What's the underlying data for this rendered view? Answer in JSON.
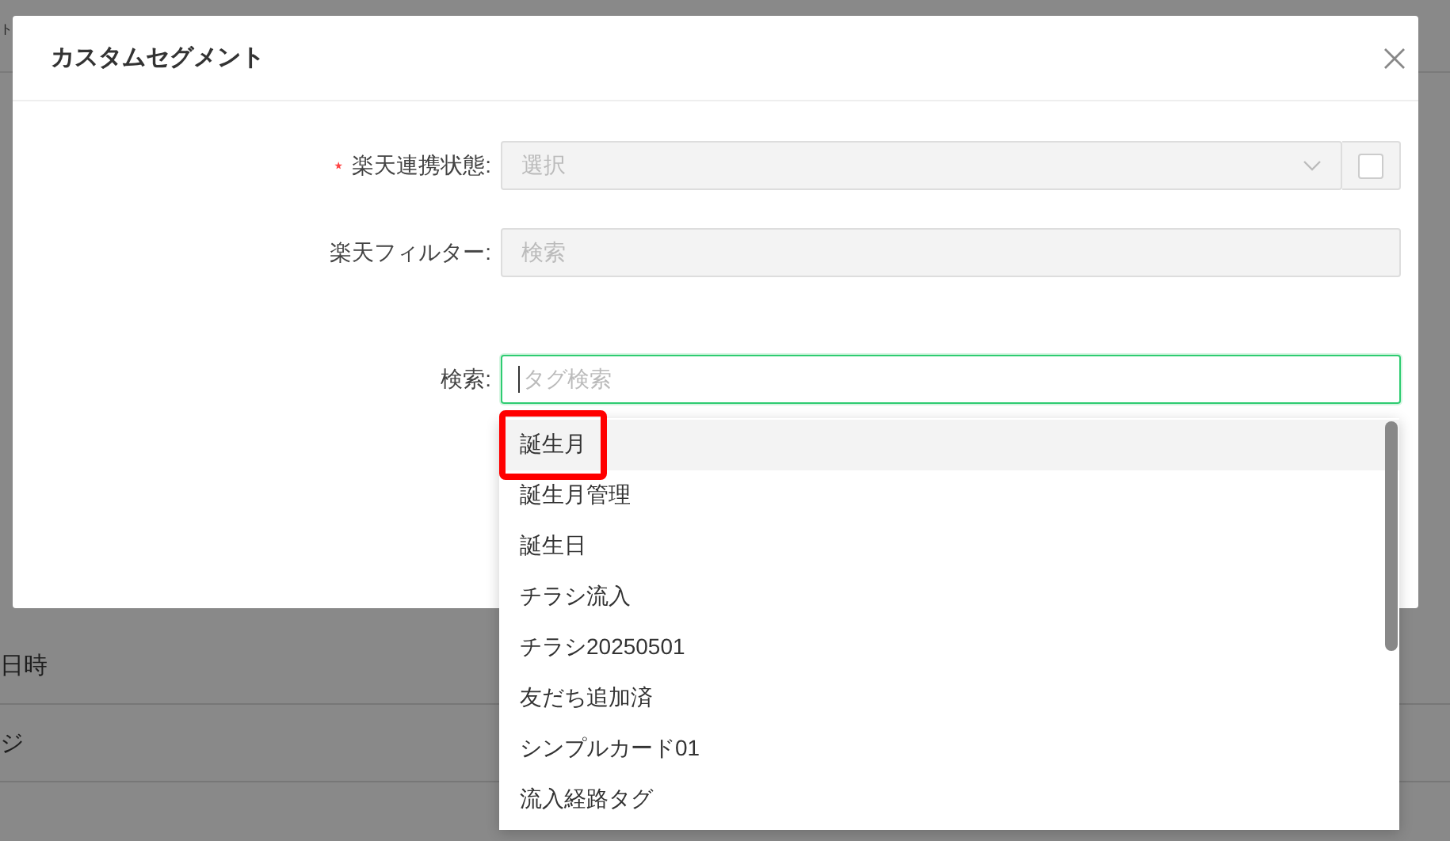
{
  "background_page": {
    "header_text": "ト",
    "rows": [
      {
        "label": "日時"
      },
      {
        "label": "ジ"
      }
    ]
  },
  "dialog": {
    "title": "カスタムセグメント",
    "form": [
      {
        "kind": "select",
        "label": "楽天連携状態:",
        "required": true,
        "placeholder": "選択",
        "disabled": true,
        "checkbox": {
          "checked": false
        }
      },
      {
        "kind": "text",
        "label": "楽天フィルター:",
        "required": false,
        "placeholder": "検索",
        "disabled": true
      },
      {
        "kind": "search",
        "label": "検索:",
        "required": false,
        "placeholder": "タグ検索",
        "disabled": false,
        "focused": true
      }
    ]
  },
  "dropdown": {
    "items": [
      {
        "label": "誕生月",
        "hovered": true,
        "annotated": true
      },
      {
        "label": "誕生月管理",
        "hovered": false,
        "annotated": false
      },
      {
        "label": "誕生日",
        "hovered": false,
        "annotated": false
      },
      {
        "label": "チラシ流入",
        "hovered": false,
        "annotated": false
      },
      {
        "label": "チラシ20250501",
        "hovered": false,
        "annotated": false
      },
      {
        "label": "友だち追加済",
        "hovered": false,
        "annotated": false
      },
      {
        "label": "シンプルカード01",
        "hovered": false,
        "annotated": false
      },
      {
        "label": "流入経路タグ",
        "hovered": false,
        "annotated": false
      }
    ]
  }
}
